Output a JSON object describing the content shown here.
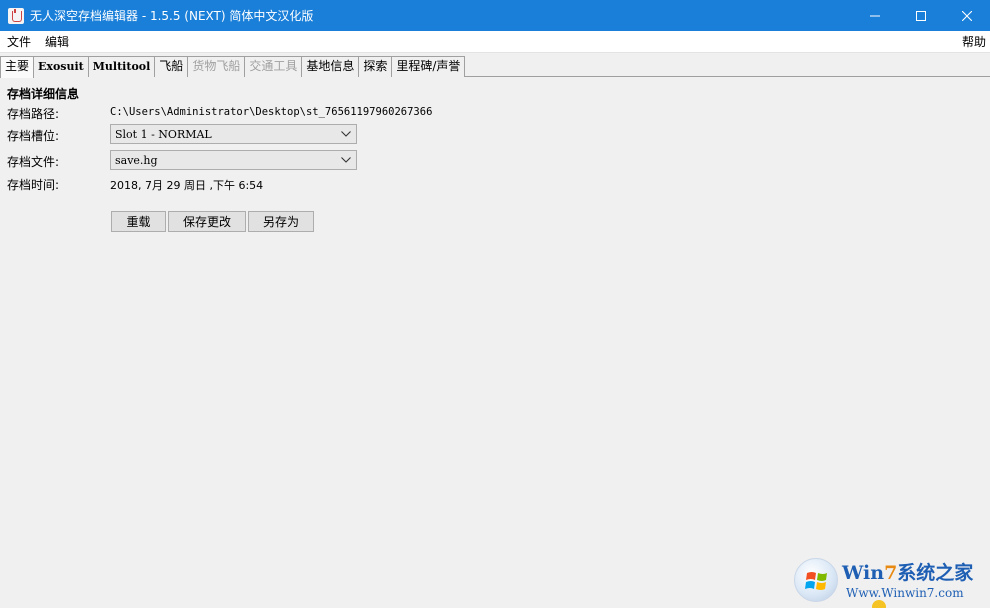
{
  "window": {
    "title": "无人深空存档编辑器 - 1.5.5 (NEXT)   简体中文汉化版",
    "minimize_glyph": "─",
    "maximize_glyph": "☐",
    "close_glyph": "✕"
  },
  "menu": {
    "file": "文件",
    "edit": "编辑",
    "help": "帮助"
  },
  "tabs": [
    {
      "label": "主要",
      "active": true,
      "enabled": true
    },
    {
      "label": "Exosuit",
      "active": false,
      "enabled": true
    },
    {
      "label": "Multitool",
      "active": false,
      "enabled": true
    },
    {
      "label": "飞船",
      "active": false,
      "enabled": true
    },
    {
      "label": "货物飞船",
      "active": false,
      "enabled": false
    },
    {
      "label": "交通工具",
      "active": false,
      "enabled": false
    },
    {
      "label": "基地信息",
      "active": false,
      "enabled": true
    },
    {
      "label": "探索",
      "active": false,
      "enabled": true
    },
    {
      "label": "里程碑/声誉",
      "active": false,
      "enabled": true
    }
  ],
  "details": {
    "section_title": "存档详细信息",
    "path_label": "存档路径:",
    "path_value": "C:\\Users\\Administrator\\Desktop\\st_76561197960267366",
    "slot_label": "存档槽位:",
    "slot_value": "Slot 1 - NORMAL",
    "file_label": "存档文件:",
    "file_value": "save.hg",
    "time_label": "存档时间:",
    "time_value": "2018, 7月 29 周日  ,下午 6:54"
  },
  "buttons": {
    "reload": "重载",
    "save_changes": "保存更改",
    "save_as": "另存为"
  },
  "watermark": {
    "brand_prefix": "Wi",
    "brand_n": "n",
    "brand_seven": "7",
    "brand_suffix": "系统之家",
    "url": "Www.Winwin7.com"
  },
  "colors": {
    "titlebar": "#1a7fd9",
    "background": "#f0f0f0"
  }
}
